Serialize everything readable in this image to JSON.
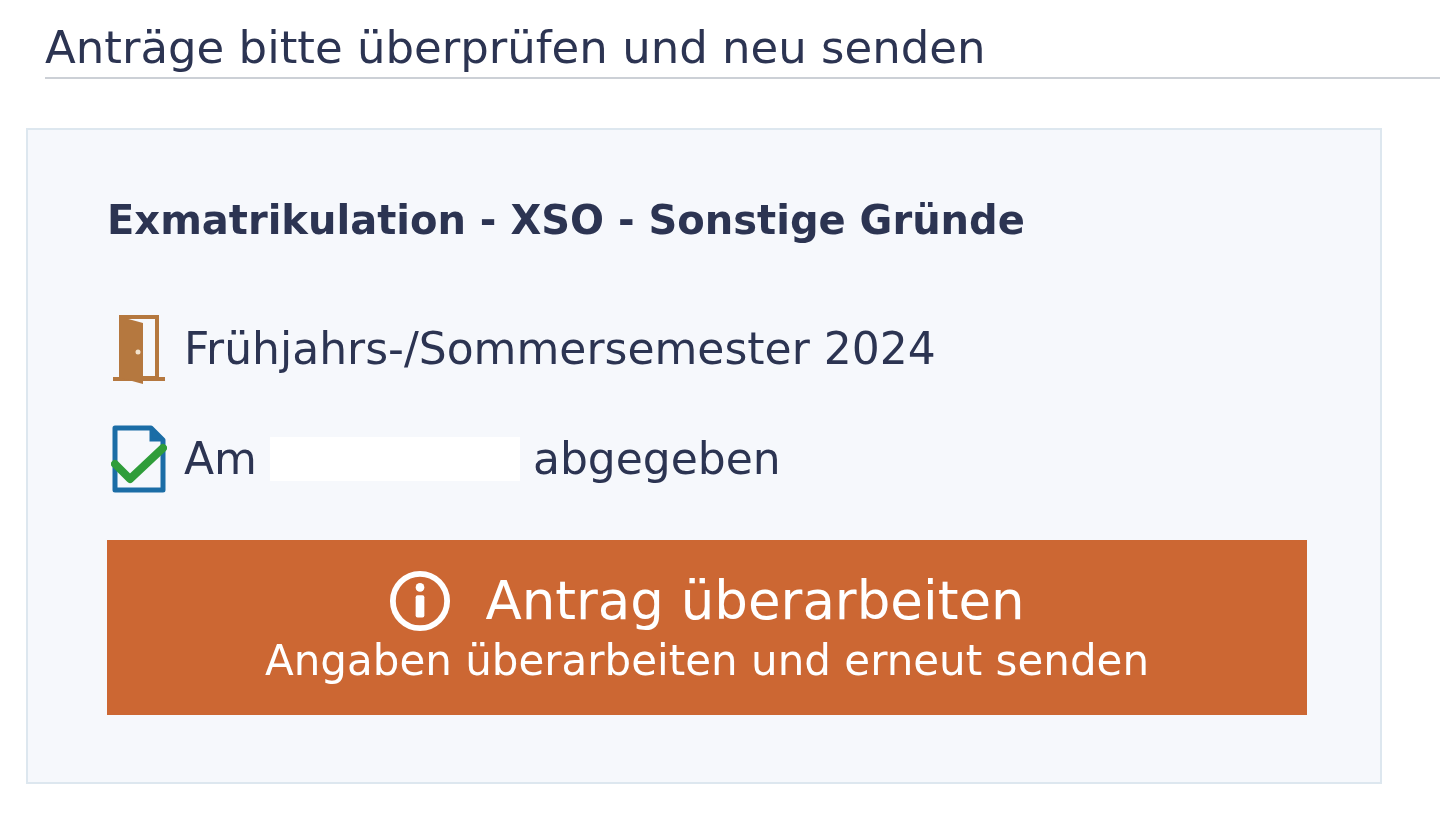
{
  "section": {
    "heading": "Anträge bitte überprüfen und neu senden"
  },
  "requests": [
    {
      "title": "Exmatrikulation - XSO - Sonstige Gründe",
      "details": [
        {
          "kind": "semester",
          "text": "Frühjahrs-/Sommersemester 2024"
        },
        {
          "kind": "submitted",
          "prefix": "Am",
          "suffix": "abgegeben"
        }
      ],
      "action": {
        "label": "Antrag überarbeiten",
        "sublabel": "Angaben überarbeiten und erneut senden"
      }
    }
  ]
}
